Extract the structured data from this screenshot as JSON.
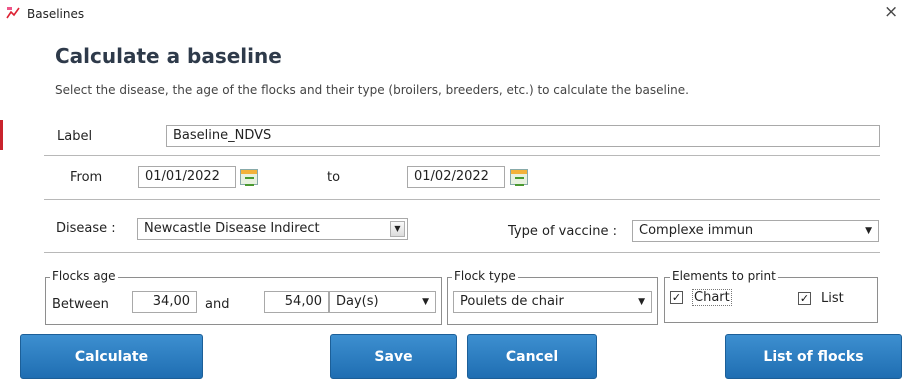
{
  "window": {
    "title": "Baselines",
    "icon": "chart-app-icon",
    "close_glyph": "×"
  },
  "header": {
    "heading": "Calculate a baseline",
    "subtitle": "Select the disease, the age of the flocks and their type (broilers, breeders, etc.) to calculate the baseline."
  },
  "label_field": {
    "label": "Label",
    "value": "Baseline_NDVS"
  },
  "dates": {
    "from_label": "From",
    "from_value": "01/01/2022",
    "to_label": "to",
    "to_value": "01/02/2022"
  },
  "disease": {
    "label": "Disease :",
    "value": "Newcastle Disease Indirect"
  },
  "vaccine": {
    "label": "Type of vaccine :",
    "value": "Complexe immun"
  },
  "flocks_age": {
    "legend": "Flocks age",
    "between_label": "Between",
    "min_value": "34,00",
    "and_label": "and",
    "max_value": "54,00",
    "unit": "Day(s)"
  },
  "flock_type": {
    "legend": "Flock type",
    "value": "Poulets de chair"
  },
  "elements_to_print": {
    "legend": "Elements to print",
    "chart_label": "Chart",
    "chart_checked": true,
    "list_label": "List",
    "list_checked": true,
    "check_glyph": "✓"
  },
  "buttons": {
    "calculate": "Calculate",
    "save": "Save",
    "cancel": "Cancel",
    "list_of_flocks": "List of flocks"
  },
  "colors": {
    "accent": "#2574b9",
    "heading": "#2e3a4a",
    "left_bar": "#c9232d"
  }
}
